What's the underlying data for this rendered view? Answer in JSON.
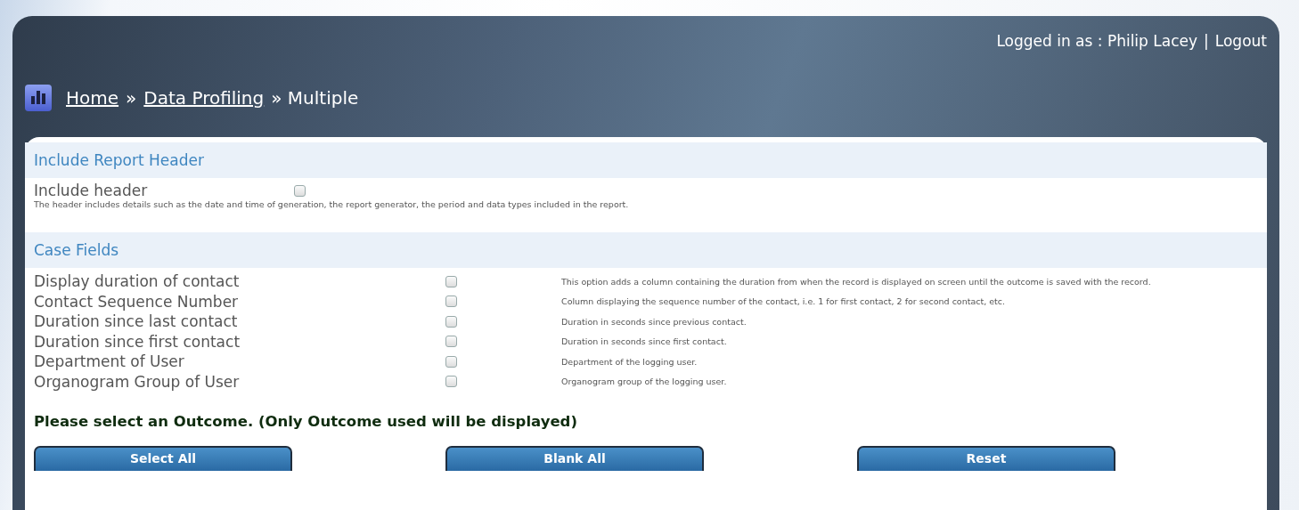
{
  "header": {
    "login_label": "Logged in as : Philip Lacey",
    "separator": "|",
    "logout": "Logout",
    "breadcrumb": [
      {
        "label": "Home",
        "link": true
      },
      {
        "label": "»",
        "link": false
      },
      {
        "label": "Data Profiling",
        "link": true
      },
      {
        "label": "» Multiple",
        "link": false
      }
    ]
  },
  "report_header": {
    "title": "Include Report Header",
    "option": {
      "label": "Include header",
      "checked": false
    },
    "description": "The header includes details such as the date and time of generation, the report generator, the period and data types included in the report."
  },
  "case_fields": {
    "title": "Case Fields",
    "rows": [
      {
        "label": "Display duration of contact",
        "checked": false,
        "description": "This option adds a column containing the duration from when the record is displayed on screen until the outcome is saved with the record."
      },
      {
        "label": "Contact Sequence Number",
        "checked": false,
        "description": "Column displaying the sequence number of the contact, i.e. 1 for first contact, 2 for second contact, etc."
      },
      {
        "label": "Duration since last contact",
        "checked": false,
        "description": "Duration in seconds since previous contact."
      },
      {
        "label": "Duration since first contact",
        "checked": false,
        "description": "Duration in seconds since first contact."
      },
      {
        "label": "Department of User",
        "checked": false,
        "description": "Department of the logging user."
      },
      {
        "label": "Organogram Group of User",
        "checked": false,
        "description": "Organogram group of the logging user."
      }
    ]
  },
  "outcome_prompt": "Please select an Outcome. (Only Outcome used will be displayed)",
  "buttons": [
    "Select All",
    "Blank All",
    "Reset"
  ]
}
